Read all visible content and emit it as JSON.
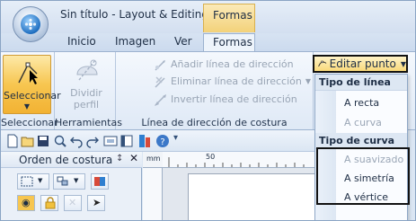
{
  "window": {
    "title": "Sin título - Layout & Editing",
    "contextual_tab_group": "Formas"
  },
  "tabs": [
    {
      "label": "Inicio",
      "active": false
    },
    {
      "label": "Imagen",
      "active": false
    },
    {
      "label": "Ver",
      "active": false
    },
    {
      "label": "Formas",
      "active": true
    }
  ],
  "ribbon": {
    "groups": [
      {
        "label": "Seleccionar",
        "button_label": "Seleccionar"
      },
      {
        "label": "Herramientas",
        "button_label": "Dividir perfil"
      },
      {
        "label": "Línea de dirección de costura",
        "buttons": [
          "Añadir línea de dirección",
          "Eliminar línea de dirección",
          "Invertir línea de dirección"
        ]
      }
    ],
    "edit_point_button": "Editar punto"
  },
  "dropdown": {
    "section_line": "Tipo de línea",
    "line_items": [
      {
        "label": "A recta",
        "enabled": true
      },
      {
        "label": "A curva",
        "enabled": false
      }
    ],
    "section_curve": "Tipo de curva",
    "curve_items": [
      {
        "label": "A suavizado",
        "enabled": false
      },
      {
        "label": "A simetría",
        "enabled": true
      },
      {
        "label": "A vértice",
        "enabled": true
      }
    ]
  },
  "panel": {
    "title": "Orden de costura",
    "pin_symbol": "↕",
    "close_symbol": "✕"
  },
  "ruler": {
    "unit": "mm",
    "label_50": "50"
  },
  "qat_icons": [
    "new-icon",
    "open-icon",
    "save-icon",
    "zoom-icon",
    "undo-icon",
    "redo-icon",
    "view-icon",
    "panel-icon",
    "color-icon",
    "help-icon",
    "customize-icon"
  ],
  "colors": {
    "accent_orange": "#f7c650",
    "ribbon_blue": "#dbe6f3",
    "disabled_text": "#9aa6b6"
  }
}
